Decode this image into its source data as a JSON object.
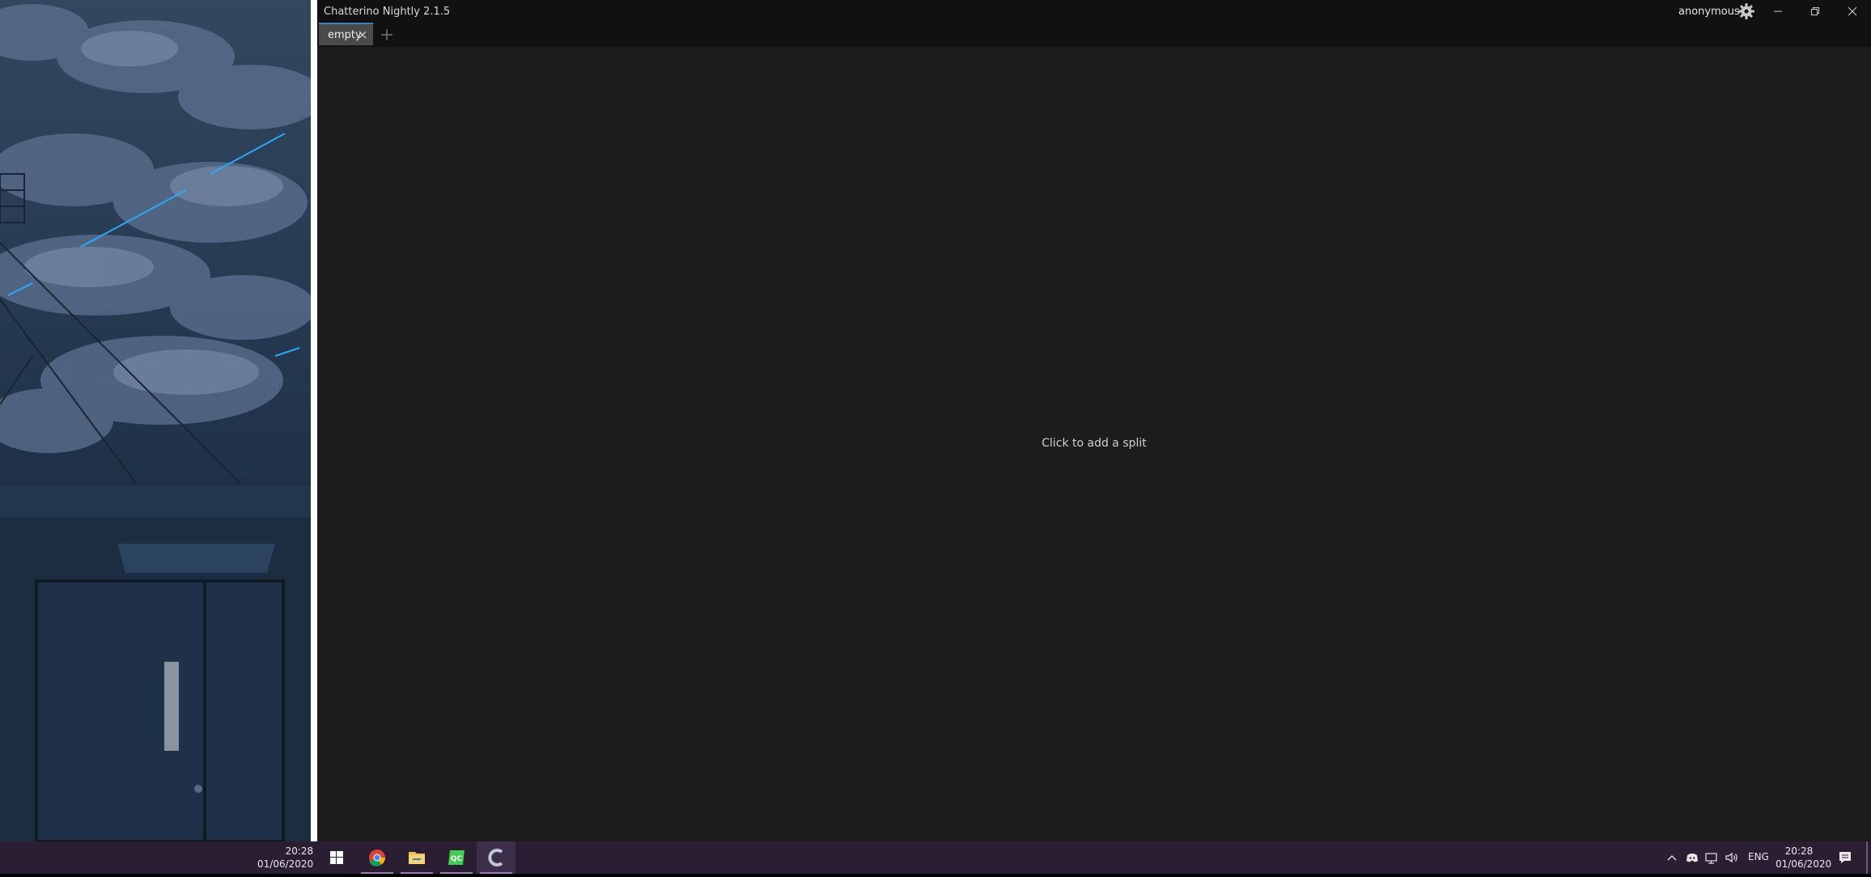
{
  "window": {
    "title": "Chatterino Nightly 2.1.5",
    "username": "anonymous"
  },
  "tabs": [
    {
      "label": "empty",
      "selected": true
    }
  ],
  "content": {
    "empty_hint": "Click to add a split"
  },
  "taskbar": {
    "left_clock": {
      "time": "20:28",
      "date": "01/06/2020"
    },
    "pinned_apps": [
      "windows-start",
      "chrome",
      "file-explorer",
      "qt-creator",
      "chatterino"
    ],
    "tray_language": "ENG",
    "right_clock": {
      "time": "20:28",
      "date": "01/06/2020"
    }
  },
  "colors": {
    "window_bg": "#1c1c1c",
    "titlebar_bg": "#111111",
    "tab_selected_bg": "#4a4a4a",
    "tab_accent": "#3b82c4",
    "taskbar_bg": "#2b1e33"
  }
}
